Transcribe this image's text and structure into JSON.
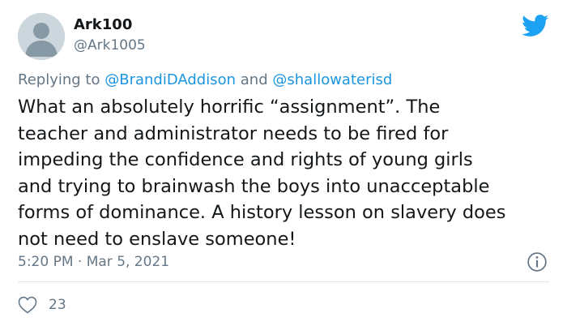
{
  "author": {
    "name": "Ark100",
    "handle": "@Ark1005"
  },
  "reply": {
    "prefix": "Replying to",
    "mention_1": "@BrandiDAddison",
    "conjunction": "and",
    "mention_2": "@shallowaterisd"
  },
  "body_lines": [
    "What an absolutely horrific “assignment”. The",
    "teacher and administrator needs to be fired for",
    "impeding the confidence and rights of young girls",
    "and trying to brainwash the boys into unacceptable",
    "forms of dominance. A history lesson on slavery does",
    "not need to enslave someone!"
  ],
  "timestamp": "5:20 PM · Mar 5, 2021",
  "like_count": "23",
  "icons": {
    "logo": "twitter-bird-icon",
    "info": "info-icon",
    "like": "heart-icon"
  },
  "colors": {
    "brand": "#1da1f2",
    "mention": "#1b95e0",
    "muted": "#657786",
    "text": "#14171a"
  }
}
